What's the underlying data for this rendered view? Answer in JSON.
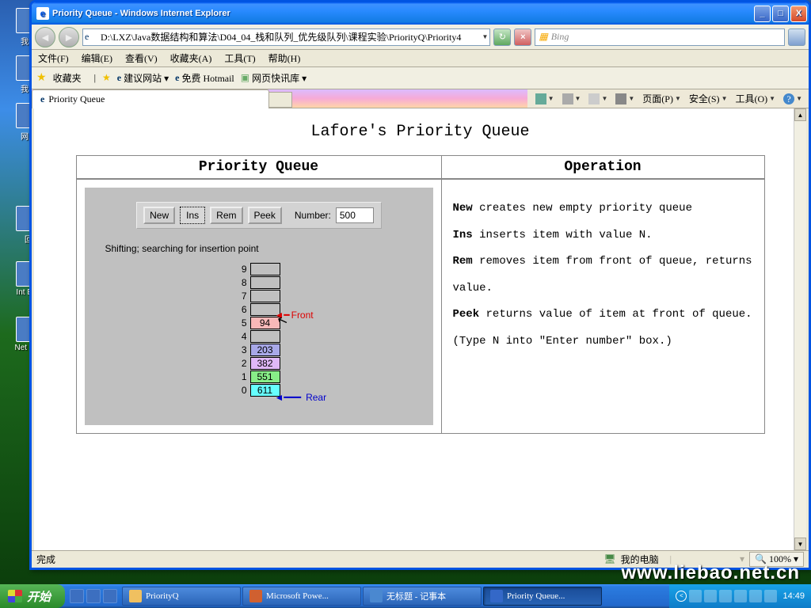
{
  "desktop": {
    "icons": [
      "我的",
      "我山",
      "网上",
      "回",
      "Int Exp",
      "Net IDE"
    ]
  },
  "window": {
    "title": "Priority Queue - Windows Internet Explorer"
  },
  "nav": {
    "address": "D:\\LXZ\\Java数据结构和算法\\D04_04_栈和队列_优先级队列\\课程实验\\PriorityQ\\Priority4",
    "search_placeholder": "Bing"
  },
  "menu": [
    "文件(F)",
    "编辑(E)",
    "查看(V)",
    "收藏夹(A)",
    "工具(T)",
    "帮助(H)"
  ],
  "favbar": {
    "label": "收藏夹",
    "links": [
      "建议网站 ▾",
      "免费 Hotmail",
      "网页快讯库 ▾"
    ]
  },
  "tab": {
    "title": "Priority Queue"
  },
  "tabtools": [
    "页面(P)",
    "安全(S)",
    "工具(O)"
  ],
  "page": {
    "title": "Lafore's Priority Queue",
    "left_head": "Priority Queue",
    "right_head": "Operation",
    "buttons": [
      "New",
      "Ins",
      "Rem",
      "Peek"
    ],
    "number_label": "Number:",
    "number_value": "500",
    "status": "Shifting; searching for insertion point",
    "cells": [
      {
        "i": 0,
        "v": "611",
        "c": "#66ffff"
      },
      {
        "i": 1,
        "v": "551",
        "c": "#88ee88"
      },
      {
        "i": 2,
        "v": "382",
        "c": "#e0b8f8"
      },
      {
        "i": 3,
        "v": "203",
        "c": "#a8a8e8"
      },
      {
        "i": 4,
        "v": "",
        "c": "#c0c0c0"
      },
      {
        "i": 5,
        "v": "94",
        "c": "#f8b8b8"
      },
      {
        "i": 6,
        "v": "",
        "c": "#c0c0c0"
      },
      {
        "i": 7,
        "v": "",
        "c": "#c0c0c0"
      },
      {
        "i": 8,
        "v": "",
        "c": "#c0c0c0"
      },
      {
        "i": 9,
        "v": "",
        "c": "#c0c0c0"
      }
    ],
    "front_label": "Front",
    "rear_label": "Rear",
    "ops": [
      {
        "b": "New",
        "t": " creates new empty priority queue"
      },
      {
        "b": "Ins",
        "t": " inserts item with value N."
      },
      {
        "b": "Rem",
        "t": " removes item from front of queue, returns value."
      },
      {
        "b": "Peek",
        "t": " returns value of item at front of queue."
      }
    ],
    "hint": "(Type N into \"Enter number\" box.)"
  },
  "statusbar": {
    "done": "完成",
    "zone": "我的电脑",
    "zoom": "100%"
  },
  "watermark": "www.liebao.net.cn",
  "taskbar": {
    "start": "开始",
    "tasks": [
      {
        "label": "PriorityQ",
        "active": false
      },
      {
        "label": "Microsoft Powe...",
        "active": false
      },
      {
        "label": "无标题 - 记事本",
        "active": false
      },
      {
        "label": "Priority Queue...",
        "active": true
      }
    ],
    "time": "14:49"
  }
}
